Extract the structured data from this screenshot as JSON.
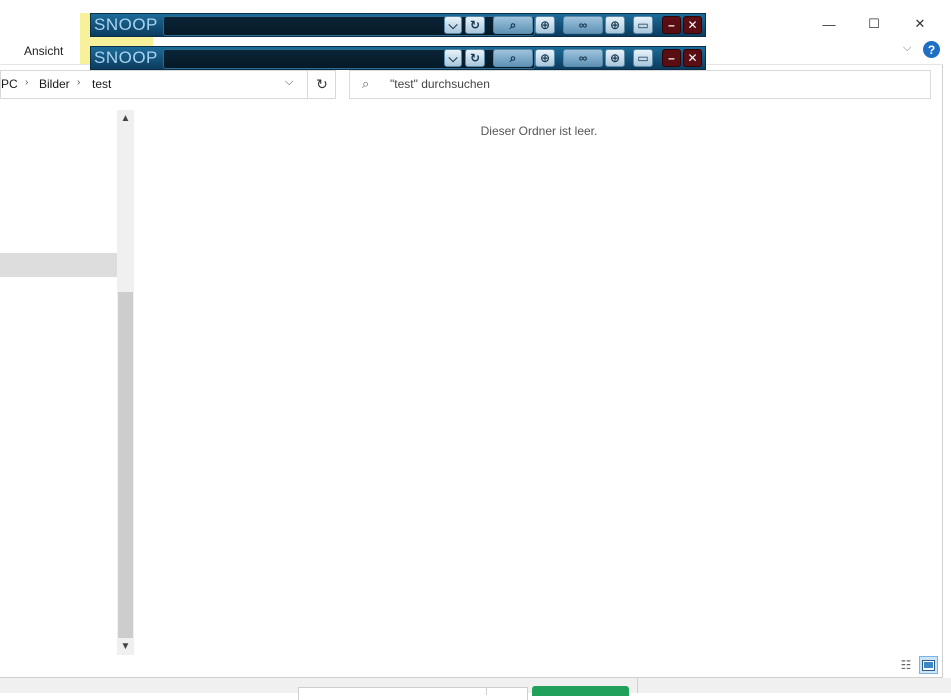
{
  "ribbon": {
    "tab_ansicht": "Ansicht"
  },
  "window_controls": {
    "minimize": "—",
    "maximize": "☐",
    "close": "✕"
  },
  "help": {
    "label": "?"
  },
  "address": {
    "crumbs": [
      "PC",
      "Bilder",
      "test"
    ],
    "separator": "›",
    "dropdown": "⌵",
    "refresh": "↻"
  },
  "search": {
    "placeholder": "\"test\" durchsuchen",
    "icon": "search-icon"
  },
  "content": {
    "empty_message": "Dieser Ordner ist leer."
  },
  "snoop": {
    "title": "SNOOP",
    "toolbars": 2,
    "buttons": [
      "dropdown",
      "refresh",
      "search",
      "target",
      "binoculars",
      "target",
      "window",
      "minimize",
      "close"
    ],
    "colors": {
      "bar": "#0f4a70",
      "accent": "#a9d4f1",
      "close": "#5a0d12"
    }
  },
  "colors": {
    "ribbon_highlight": "#f6f19a",
    "help_icon": "#1f6fc5",
    "selected_view": "#cce4f7",
    "ok_button": "#21a05a"
  }
}
